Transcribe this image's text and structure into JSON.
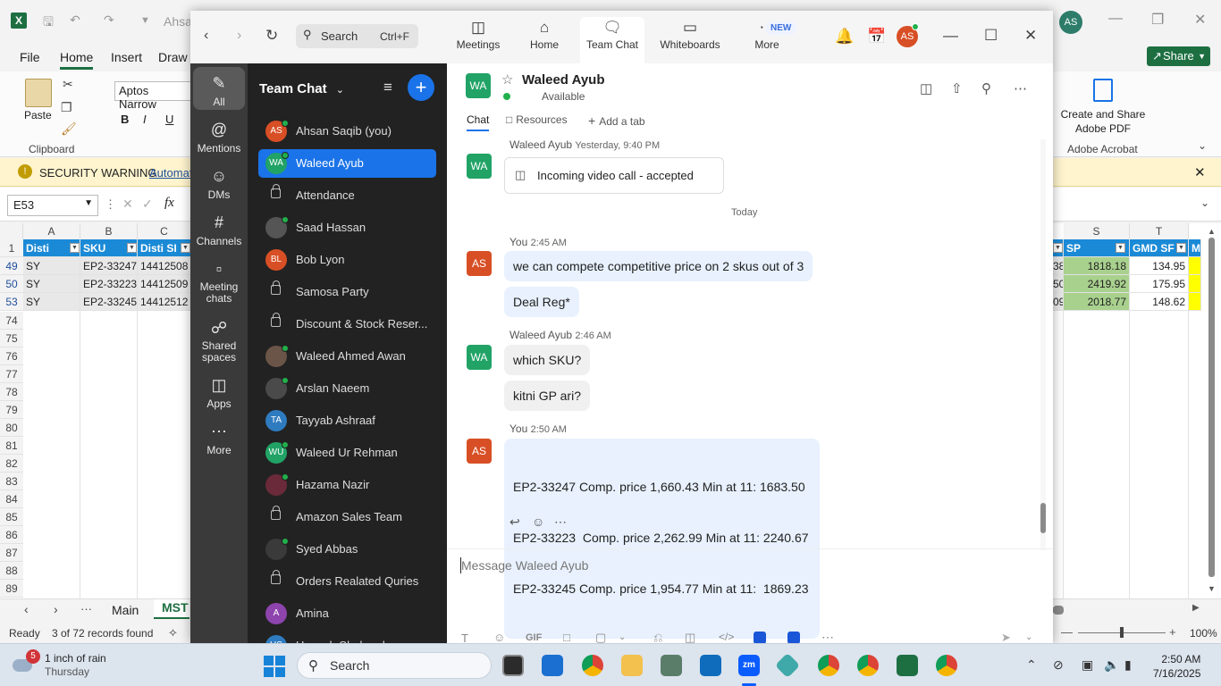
{
  "excel": {
    "logo": "X",
    "title_fragment": "Ahsan",
    "avatar": "AS",
    "menu": {
      "file": "File",
      "home": "Home",
      "insert": "Insert",
      "draw": "Draw"
    },
    "share": "Share",
    "paste": "Paste",
    "clipboard": "Clipboard",
    "font": "Aptos Narrow",
    "bold": "B",
    "italic": "I",
    "underline": "U",
    "create_pdf": "Create and Share Adobe PDF",
    "adobe": "Adobe Acrobat",
    "security_warning": "SECURITY WARNING",
    "security_more": "Automat",
    "name_box": "E53",
    "fx": "fx",
    "columns": [
      "A",
      "B",
      "C"
    ],
    "right_columns": [
      "S",
      "T"
    ],
    "header_row": {
      "num": "1",
      "a": "Disti",
      "b": "SKU",
      "c": "Disti SI",
      "s": "SP",
      "t": "GMD SF",
      "u": "M"
    },
    "rows": [
      {
        "num": "49",
        "a": "SY",
        "b": "EP2-33247",
        "c": "14412508",
        "r": "38",
        "s": "1818.18",
        "t": "134.95"
      },
      {
        "num": "50",
        "a": "SY",
        "b": "EP2-33223",
        "c": "14412509",
        "r": "50",
        "s": "2419.92",
        "t": "175.95"
      },
      {
        "num": "53",
        "a": "SY",
        "b": "EP2-33245",
        "c": "14412512",
        "r": "09",
        "s": "2018.77",
        "t": "148.62"
      }
    ],
    "empty_rows": [
      "74",
      "75",
      "76",
      "77",
      "78",
      "79",
      "80",
      "81",
      "82",
      "83",
      "84",
      "85",
      "86",
      "87",
      "88",
      "89"
    ],
    "sheet_tabs": {
      "more": "···",
      "main": "Main",
      "mst": "MST"
    },
    "status": {
      "ready": "Ready",
      "records": "3 of 72 records found",
      "zoom": "100%"
    }
  },
  "teams": {
    "search": {
      "label": "Search",
      "shortcut": "Ctrl+F"
    },
    "tabs": {
      "meetings": "Meetings",
      "home": "Home",
      "team_chat": "Team Chat",
      "whiteboards": "Whiteboards",
      "more": "More",
      "new_badge": "NEW"
    },
    "user_avatar": "AS",
    "rail": {
      "all": "All",
      "mentions": "Mentions",
      "dms": "DMs",
      "channels": "Channels",
      "meeting_chats": "Meeting chats",
      "shared_spaces": "Shared spaces",
      "apps": "Apps",
      "more": "More"
    },
    "list_title": "Team Chat",
    "contacts": [
      {
        "name": "Ahsan Saqib (you)",
        "initials": "AS",
        "color": "#d84f25",
        "type": "avatar",
        "online": true
      },
      {
        "name": "Waleed Ayub",
        "initials": "WA",
        "color": "#21a366",
        "type": "avatar",
        "online": true
      },
      {
        "name": "Attendance",
        "type": "lock"
      },
      {
        "name": "Saad Hassan",
        "initials": "",
        "color": "#555555",
        "type": "photo",
        "online": true
      },
      {
        "name": "Bob Lyon",
        "initials": "BL",
        "color": "#d84f25",
        "type": "avatar",
        "online": false
      },
      {
        "name": "Samosa Party",
        "type": "lock"
      },
      {
        "name": "Discount & Stock Reser...",
        "type": "lock"
      },
      {
        "name": "Waleed Ahmed Awan",
        "initials": "",
        "color": "#6b5548",
        "type": "photo",
        "online": true
      },
      {
        "name": "Arslan Naeem",
        "initials": "",
        "color": "#4a4a4a",
        "type": "photo",
        "online": true
      },
      {
        "name": "Tayyab Ashraaf",
        "initials": "TA",
        "color": "#2f7bbf",
        "type": "avatar",
        "online": false
      },
      {
        "name": "Waleed Ur Rehman",
        "initials": "WU",
        "color": "#21a366",
        "type": "avatar",
        "online": true
      },
      {
        "name": "Hazama Nazir",
        "initials": "",
        "color": "#6a2a3a",
        "type": "photo",
        "online": true
      },
      {
        "name": "Amazon Sales Team",
        "type": "lock"
      },
      {
        "name": "Syed Abbas",
        "initials": "",
        "color": "#3a3a3a",
        "type": "photo",
        "online": true
      },
      {
        "name": "Orders Realated Quries",
        "type": "lock"
      },
      {
        "name": "Amina",
        "initials": "A",
        "color": "#8e44ad",
        "type": "avatar",
        "online": false
      },
      {
        "name": "Haseeb Shahzad",
        "initials": "HS",
        "color": "#2f7bbf",
        "type": "avatar",
        "online": false
      }
    ],
    "chat": {
      "contact_initials": "WA",
      "contact_name": "Waleed Ayub",
      "status": "Available",
      "tabs": {
        "chat": "Chat",
        "resources": "Resources",
        "add_tab": "Add a tab"
      },
      "call_meta_name": "Waleed Ayub",
      "call_meta_time": "Yesterday, 9:40 PM",
      "call_text": "Incoming video call - accepted",
      "day_separator": "Today",
      "msg1_meta_name": "You",
      "msg1_meta_time": "2:45 AM",
      "msg1_text": "we can compete competitive price on 2 skus out of 3",
      "msg2_text": "Deal Reg*",
      "msg3_meta_name": "Waleed Ayub",
      "msg3_meta_time": "2:46 AM",
      "msg3_text": "which SKU?",
      "msg4_text": "kitni GP ari?",
      "msg5_meta_name": "You",
      "msg5_meta_time": "2:50 AM",
      "msg5_lines": [
        "EP2-33247 Comp. price 1,660.43 Min at 11: 1683.50",
        "EP2-33223  Comp. price 2,262.99 Min at 11: 2240.67",
        "EP2-33245 Comp. price 1,954.77 Min at 11:  1869.23"
      ],
      "my_initials": "AS",
      "composer_placeholder": "Message Waleed Ayub",
      "gif": "GIF"
    }
  },
  "taskbar": {
    "weather_badge": "5",
    "weather_line1": "1 inch of rain",
    "weather_line2": "Thursday",
    "search": "Search",
    "time": "2:50 AM",
    "date": "7/16/2025"
  }
}
